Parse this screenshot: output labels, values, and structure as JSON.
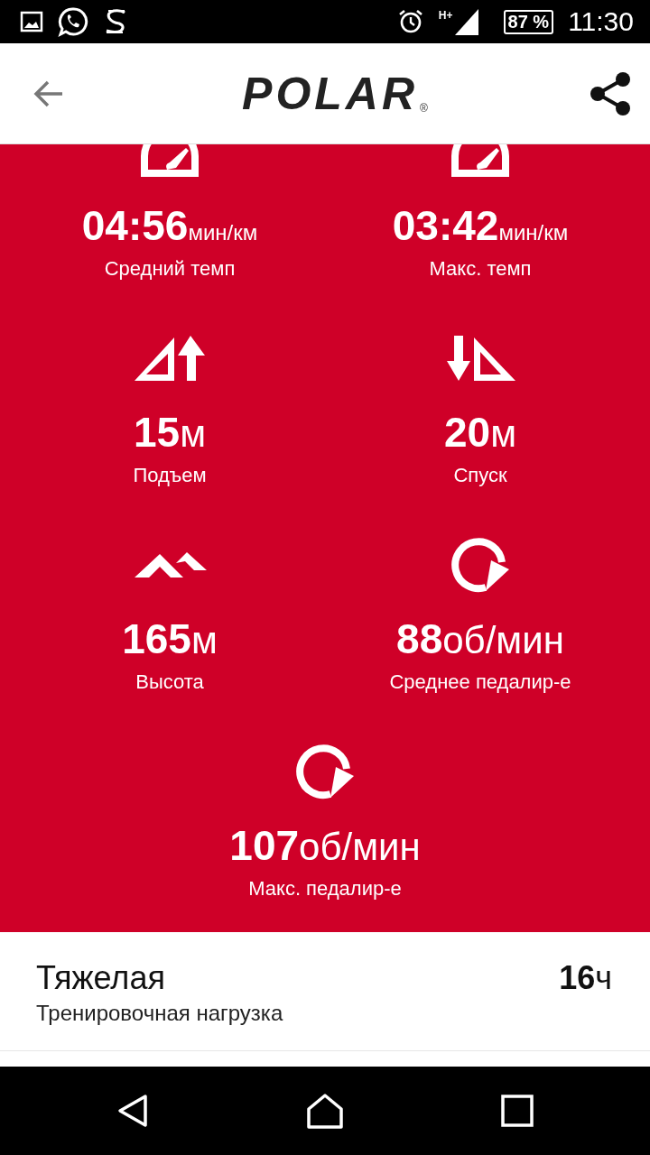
{
  "status_bar": {
    "network": "H+",
    "battery": "87 %",
    "time": "11:30"
  },
  "app_bar": {
    "logo": "POLAR",
    "logo_mark": "®"
  },
  "stats": [
    {
      "kind": "pace",
      "value": "04:56",
      "unit": "мин/км",
      "label": "Средний темп"
    },
    {
      "kind": "pace",
      "value": "03:42",
      "unit": "мин/км",
      "label": "Макс. темп"
    },
    {
      "kind": "ascent",
      "value": "15",
      "unit": "м",
      "label": "Подъем"
    },
    {
      "kind": "descent",
      "value": "20",
      "unit": "м",
      "label": "Спуск"
    },
    {
      "kind": "altitude",
      "value": "165",
      "unit": "м",
      "label": "Высота"
    },
    {
      "kind": "cadence",
      "value": "88",
      "unit": "об/мин",
      "label": "Среднее педалир-е"
    },
    {
      "kind": "cadence",
      "value": "107",
      "unit": "об/мин",
      "label": "Макс. педалир-е"
    }
  ],
  "training_load": {
    "level": "Тяжелая",
    "label": "Тренировочная нагрузка",
    "value": "16",
    "unit": "ч"
  }
}
